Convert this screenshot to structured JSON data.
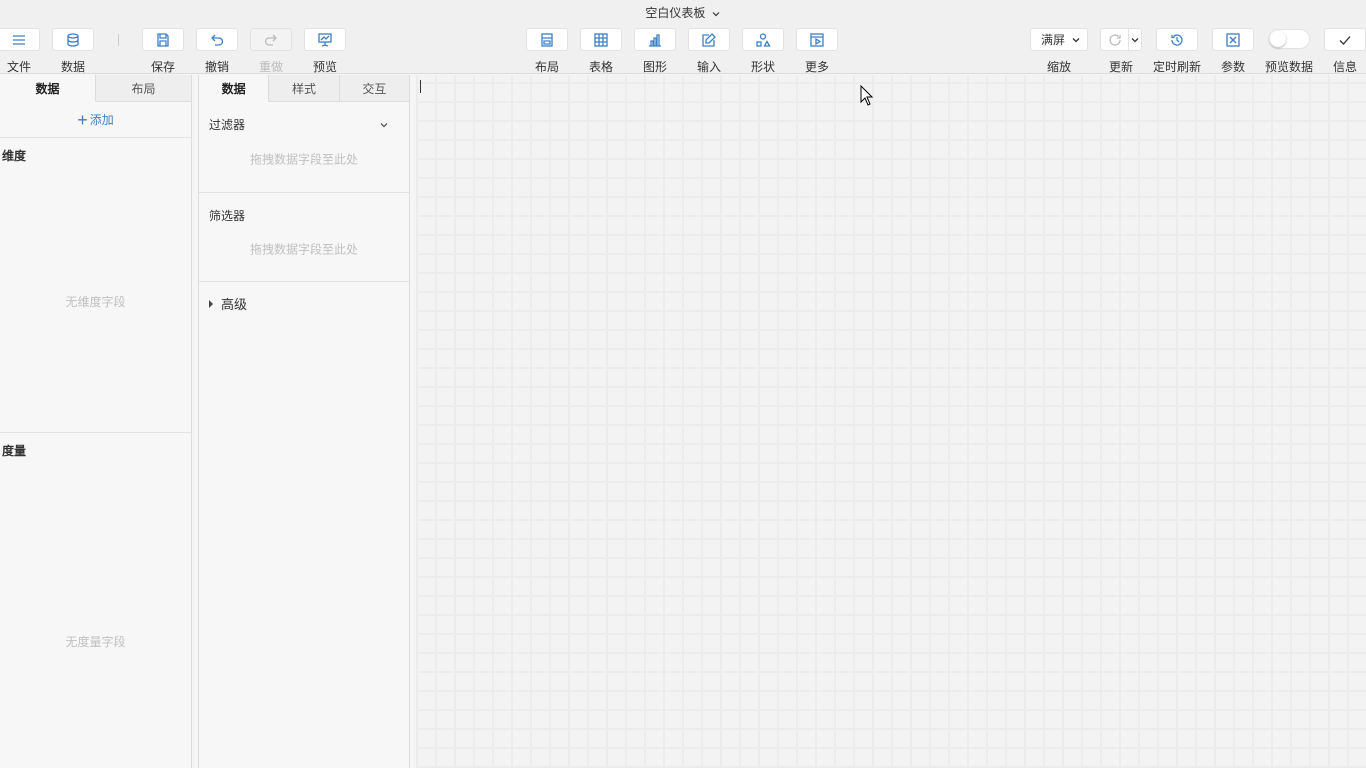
{
  "app": {
    "title": "空白仪表板"
  },
  "toolbar": {
    "left": [
      {
        "name": "menu",
        "label": "文件",
        "icon": "menu-icon"
      },
      {
        "name": "data",
        "label": "数据",
        "icon": "database-icon"
      },
      {
        "name": "save",
        "label": "保存",
        "icon": "save-icon"
      },
      {
        "name": "undo",
        "label": "撤销",
        "icon": "undo-icon"
      },
      {
        "name": "redo",
        "label": "重做",
        "icon": "redo-icon",
        "disabled": true
      },
      {
        "name": "preview",
        "label": "预览",
        "icon": "presentation-icon"
      }
    ],
    "center": [
      {
        "name": "layout",
        "label": "布局",
        "icon": "layout-icon"
      },
      {
        "name": "table",
        "label": "表格",
        "icon": "table-icon"
      },
      {
        "name": "chart",
        "label": "图形",
        "icon": "bar-chart-icon"
      },
      {
        "name": "input",
        "label": "输入",
        "icon": "edit-icon"
      },
      {
        "name": "shape",
        "label": "形状",
        "icon": "shapes-icon"
      },
      {
        "name": "more",
        "label": "更多",
        "icon": "play-box-icon"
      }
    ],
    "right": {
      "zoom": {
        "label": "缩放",
        "value": "满屏"
      },
      "refresh": {
        "label": "更新"
      },
      "timed_refresh": {
        "label": "定时刷新"
      },
      "params": {
        "label": "参数"
      },
      "preview_data": {
        "label": "预览数据",
        "enabled": false
      },
      "info": {
        "label": "信息"
      }
    }
  },
  "left_panel": {
    "tabs": [
      {
        "label": "数据",
        "active": true
      },
      {
        "label": "布局",
        "active": false
      }
    ],
    "add_label": "添加",
    "dimensions": {
      "title": "维度",
      "empty": "无维度字段"
    },
    "measures": {
      "title": "度量",
      "empty": "无度量字段"
    }
  },
  "middle_panel": {
    "tabs": [
      {
        "label": "数据",
        "active": true
      },
      {
        "label": "样式",
        "active": false
      },
      {
        "label": "交互",
        "active": false
      }
    ],
    "filter": {
      "title": "过滤器",
      "placeholder": "拖拽数据字段至此处"
    },
    "selector": {
      "title": "筛选器",
      "placeholder": "拖拽数据字段至此处"
    },
    "advanced": {
      "title": "高级"
    }
  },
  "colors": {
    "accent": "#3d7fc6",
    "toolbar_bg": "#f0f0f0",
    "panel_bg": "#f7f7f7",
    "muted_text": "#c0c0c0"
  }
}
